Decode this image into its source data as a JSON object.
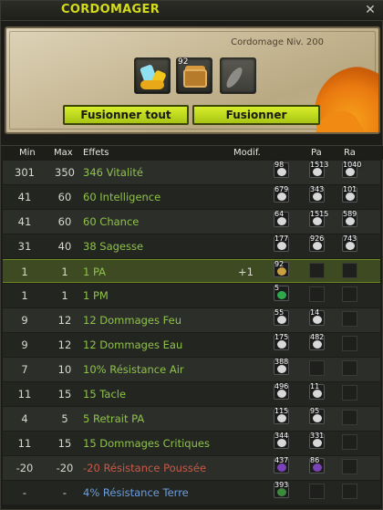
{
  "window": {
    "title": "CORDOMAGER",
    "close_icon": "close-icon"
  },
  "panel": {
    "level_text": "Cordomage Niv. 200",
    "slots": [
      {
        "icon": "gem-pile-icon",
        "qty": ""
      },
      {
        "icon": "treasure-chest-icon",
        "qty": "92"
      },
      {
        "icon": "feather-icon",
        "qty": ""
      }
    ],
    "buttons": {
      "fuse_all": "Fusionner tout",
      "fuse": "Fusionner"
    }
  },
  "table": {
    "headers": {
      "min": "Min",
      "max": "Max",
      "effects": "Effets",
      "modif": "Modif.",
      "pa": "Pa",
      "ra": "Ra"
    },
    "rows": [
      {
        "min": "301",
        "max": "350",
        "effect": "346 Vitalité",
        "tone": "green",
        "modif": "",
        "r1": "98",
        "r2": "1513",
        "r3": "1040",
        "c1": "#d8d8d8",
        "c2": "#d8d8d8",
        "c3": "#d8d8d8"
      },
      {
        "min": "41",
        "max": "60",
        "effect": "60 Intelligence",
        "tone": "green",
        "modif": "",
        "r1": "679",
        "r2": "343",
        "r3": "101",
        "c1": "#d8d8d8",
        "c2": "#d8d8d8",
        "c3": "#d8d8d8"
      },
      {
        "min": "41",
        "max": "60",
        "effect": "60 Chance",
        "tone": "green",
        "modif": "",
        "r1": "64",
        "r2": "1515",
        "r3": "589",
        "c1": "#d8d8d8",
        "c2": "#d8d8d8",
        "c3": "#d8d8d8"
      },
      {
        "min": "31",
        "max": "40",
        "effect": "38 Sagesse",
        "tone": "green",
        "modif": "",
        "r1": "177",
        "r2": "926",
        "r3": "743",
        "c1": "#d8d8d8",
        "c2": "#d8d8d8",
        "c3": "#d8d8d8"
      },
      {
        "min": "1",
        "max": "1",
        "effect": "1 PA",
        "tone": "green",
        "modif": "+1",
        "r1": "92",
        "r2": "",
        "r3": "",
        "c1": "#c8a040",
        "c2": "",
        "c3": "",
        "selected": true
      },
      {
        "min": "1",
        "max": "1",
        "effect": "1 PM",
        "tone": "green",
        "modif": "",
        "r1": "5",
        "r2": "",
        "r3": "",
        "c1": "#2ea84a",
        "c2": "",
        "c3": ""
      },
      {
        "min": "9",
        "max": "12",
        "effect": "12 Dommages Feu",
        "tone": "green",
        "modif": "",
        "r1": "55",
        "r2": "14",
        "r3": "",
        "c1": "#d8d8d8",
        "c2": "#d8d8d8",
        "c3": ""
      },
      {
        "min": "9",
        "max": "12",
        "effect": "12 Dommages Eau",
        "tone": "green",
        "modif": "",
        "r1": "175",
        "r2": "482",
        "r3": "",
        "c1": "#d8d8d8",
        "c2": "#d8d8d8",
        "c3": ""
      },
      {
        "min": "7",
        "max": "10",
        "effect": "10% Résistance Air",
        "tone": "green",
        "modif": "",
        "r1": "388",
        "r2": "",
        "r3": "",
        "c1": "#d8d8d8",
        "c2": "",
        "c3": ""
      },
      {
        "min": "11",
        "max": "15",
        "effect": "15 Tacle",
        "tone": "green",
        "modif": "",
        "r1": "496",
        "r2": "11",
        "r3": "",
        "c1": "#d8d8d8",
        "c2": "#d8d8d8",
        "c3": ""
      },
      {
        "min": "4",
        "max": "5",
        "effect": "5 Retrait PA",
        "tone": "green",
        "modif": "",
        "r1": "115",
        "r2": "95",
        "r3": "",
        "c1": "#d8d8d8",
        "c2": "#d8d8d8",
        "c3": ""
      },
      {
        "min": "11",
        "max": "15",
        "effect": "15 Dommages Critiques",
        "tone": "green",
        "modif": "",
        "r1": "344",
        "r2": "331",
        "r3": "",
        "c1": "#d8d8d8",
        "c2": "#d8d8d8",
        "c3": ""
      },
      {
        "min": "-20",
        "max": "-20",
        "effect": "-20 Résistance Poussée",
        "tone": "neg",
        "modif": "",
        "r1": "437",
        "r2": "86",
        "r3": "",
        "c1": "#7a44b8",
        "c2": "#7a44b8",
        "c3": ""
      },
      {
        "min": "-",
        "max": "-",
        "effect": "4% Résistance Terre",
        "tone": "blue",
        "modif": "",
        "r1": "393",
        "r2": "",
        "r3": "",
        "c1": "#3c8a3c",
        "c2": "",
        "c3": ""
      }
    ]
  },
  "colors": {
    "accent": "#c8dc1c",
    "effect_green": "#8fc24a",
    "effect_negative": "#c95a48",
    "effect_blue": "#6c9ee0"
  }
}
